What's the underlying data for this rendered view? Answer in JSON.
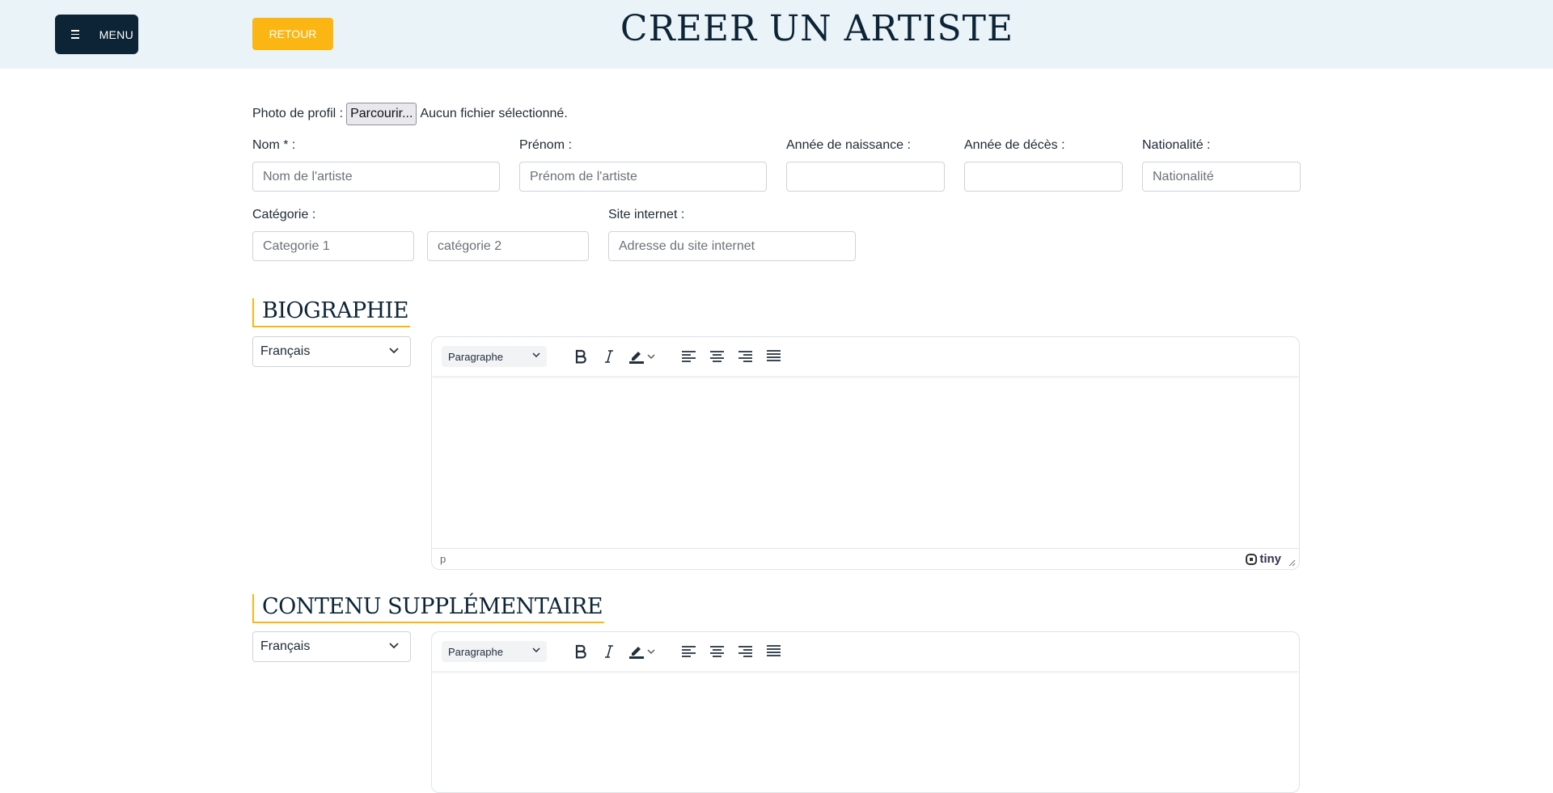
{
  "header": {
    "menu_label": "MENU",
    "back_label": "RETOUR",
    "title": "CREER UN ARTISTE"
  },
  "form": {
    "photo_label": "Photo de profil :",
    "file_button": "Parcourir...",
    "file_status": "Aucun fichier sélectionné.",
    "nom_label": "Nom * :",
    "nom_placeholder": "Nom de l'artiste",
    "prenom_label": "Prénom :",
    "prenom_placeholder": "Prénom de l'artiste",
    "naissance_label": "Année de naissance :",
    "deces_label": "Année de décès :",
    "nationalite_label": "Nationalité :",
    "nationalite_placeholder": "Nationalité",
    "categorie_label": "Catégorie :",
    "categorie1_placeholder": "Categorie 1",
    "categorie2_placeholder": "catégorie 2",
    "site_label": "Site internet :",
    "site_placeholder": "Adresse du site internet"
  },
  "biographie": {
    "title": "BIOGRAPHIE",
    "language": "Français",
    "format": "Paragraphe",
    "status_path": "p",
    "brand": "tiny"
  },
  "contenu": {
    "title": "CONTENU SUPPLÉMENTAIRE",
    "language": "Français",
    "format": "Paragraphe"
  },
  "colors": {
    "accent": "#fbb614",
    "navy": "#0d2436",
    "header_bg": "#eaf4f8"
  }
}
